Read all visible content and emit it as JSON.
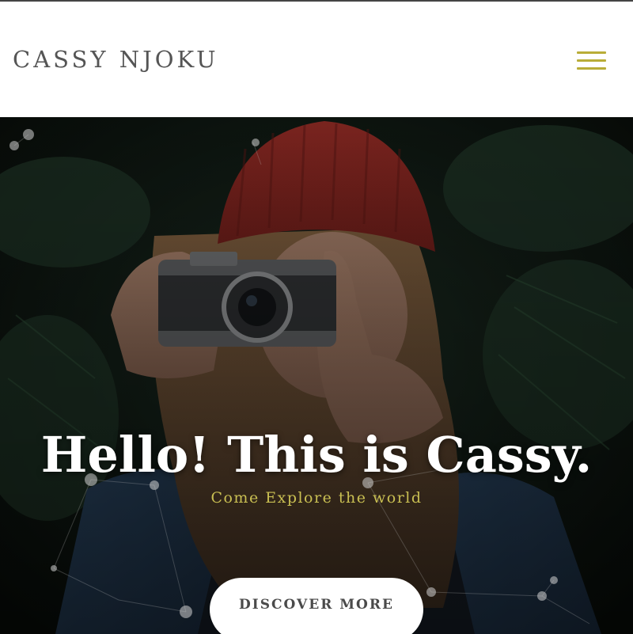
{
  "header": {
    "brand": "CASSY NJOKU",
    "menu_icon": "hamburger-menu-icon",
    "accent_color": "#b9ad38"
  },
  "hero": {
    "background_image": "photo of a woman in a red knit beanie taking a picture with a vintage camera",
    "title": "Hello! This is Cassy.",
    "subtitle": "Come Explore the world",
    "cta_label": "DISCOVER MORE",
    "subtitle_color": "#c9bf52"
  }
}
